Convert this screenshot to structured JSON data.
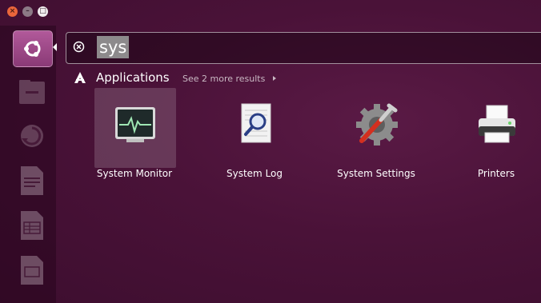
{
  "window": {
    "close_glyph": "×",
    "minimize_glyph": "–",
    "maximize_glyph": "□"
  },
  "search": {
    "value": "sys",
    "clear_icon": "clear-search-icon"
  },
  "category": {
    "title": "Applications",
    "more_link": "See 2 more results"
  },
  "apps": [
    {
      "label": "System Monitor",
      "icon": "system-monitor-icon",
      "selected": true
    },
    {
      "label": "System Log",
      "icon": "system-log-icon",
      "selected": false
    },
    {
      "label": "System Settings",
      "icon": "system-settings-icon",
      "selected": false
    },
    {
      "label": "Printers",
      "icon": "printers-icon",
      "selected": false
    }
  ],
  "colors": {
    "background": "#4a1238",
    "accent": "#8a3a76",
    "close": "#e9663b",
    "selection": "#8d8a8c"
  }
}
